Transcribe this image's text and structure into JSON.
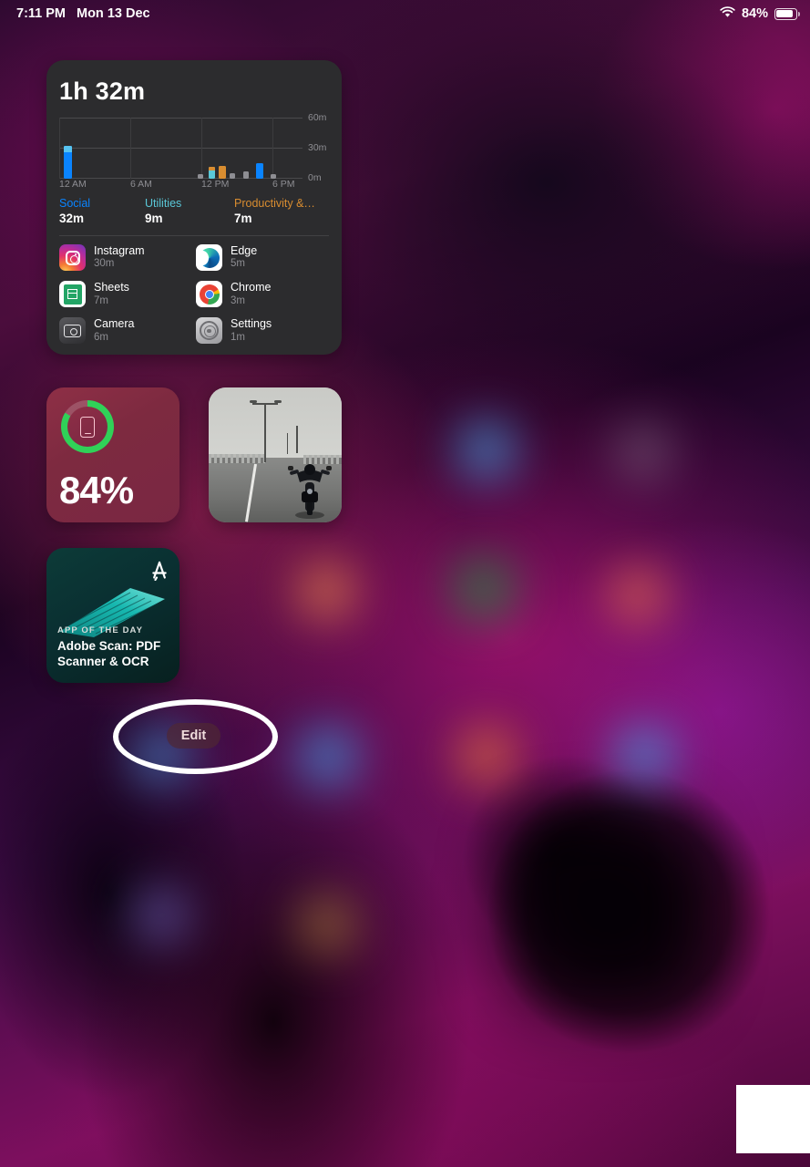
{
  "status_bar": {
    "time": "7:11 PM",
    "date": "Mon 13 Dec",
    "battery_percent": "84%",
    "wifi_icon": "wifi-icon",
    "battery_icon": "battery-icon"
  },
  "screen_time_widget": {
    "total_time": "1h 32m",
    "chart": {
      "y_ticks": [
        "60m",
        "30m",
        "0m"
      ],
      "x_ticks": [
        "12 AM",
        "6 AM",
        "12 PM",
        "6 PM"
      ]
    },
    "categories": [
      {
        "name": "Social",
        "time": "32m",
        "color": "#0a84ff"
      },
      {
        "name": "Utilities",
        "time": "9m",
        "color": "#5ac8d8"
      },
      {
        "name": "Productivity &…",
        "time": "7m",
        "color": "#d98d30"
      }
    ],
    "apps": [
      {
        "name": "Instagram",
        "time": "30m",
        "icon": "instagram-icon"
      },
      {
        "name": "Edge",
        "time": "5m",
        "icon": "edge-icon"
      },
      {
        "name": "Sheets",
        "time": "7m",
        "icon": "sheets-icon"
      },
      {
        "name": "Chrome",
        "time": "3m",
        "icon": "chrome-icon"
      },
      {
        "name": "Camera",
        "time": "6m",
        "icon": "camera-icon"
      },
      {
        "name": "Settings",
        "time": "1m",
        "icon": "settings-icon"
      }
    ]
  },
  "battery_widget": {
    "percent_label": "84%",
    "ring_color": "#30d158",
    "device_icon": "ipad-icon"
  },
  "photo_widget": {
    "description": "motorcycle-on-road-photo"
  },
  "app_store_widget": {
    "kicker": "APP OF THE DAY",
    "title": "Adobe Scan: PDF Scanner & OCR",
    "logo_icon": "app-store-icon"
  },
  "edit_button": {
    "label": "Edit"
  },
  "annotation": {
    "shape": "ellipse-highlight",
    "color": "#ffffff"
  },
  "chart_data": {
    "type": "bar",
    "title": "1h 32m",
    "xlabel": "",
    "ylabel": "",
    "ylim": [
      0,
      60
    ],
    "yticks": [
      0,
      30,
      60
    ],
    "ytick_labels": [
      "0m",
      "30m",
      "60m"
    ],
    "xtick_labels": [
      "12 AM",
      "6 AM",
      "12 PM",
      "6 PM"
    ],
    "grid": true,
    "legend_position": "below",
    "legend": [
      "Social",
      "Utilities",
      "Productivity &…"
    ],
    "series": [
      {
        "name": "Social",
        "color": "#0a84ff",
        "values": [
          32,
          0,
          0,
          0,
          0,
          0,
          0,
          0,
          0,
          0,
          0,
          0,
          0,
          0,
          0,
          0,
          0,
          5,
          0
        ]
      },
      {
        "name": "Utilities",
        "color": "#5ac8d8",
        "values": [
          0,
          0,
          0,
          0,
          0,
          0,
          0,
          0,
          0,
          0,
          0,
          4,
          0,
          0,
          0,
          0,
          0,
          0,
          0
        ]
      },
      {
        "name": "Productivity &…",
        "color": "#d98d30",
        "values": [
          0,
          0,
          0,
          0,
          0,
          0,
          0,
          0,
          0,
          0,
          0,
          1,
          6,
          0,
          0,
          0,
          0,
          0,
          0
        ]
      },
      {
        "name": "Other",
        "color": "#8e8e93",
        "values": [
          0,
          0,
          0,
          0,
          0,
          0,
          0,
          0,
          0,
          0,
          2,
          0,
          0,
          2,
          0,
          3,
          0,
          0,
          2
        ]
      }
    ],
    "x": [
      "12 AM",
      "1 AM",
      "2 AM",
      "3 AM",
      "4 AM",
      "5 AM",
      "6 AM",
      "7 AM",
      "8 AM",
      "9 AM",
      "10 AM",
      "11 AM",
      "12 PM",
      "1 PM",
      "2 PM",
      "3 PM",
      "4 PM",
      "5 PM",
      "6 PM"
    ],
    "category_totals": {
      "Social": 32,
      "Utilities": 9,
      "Productivity &…": 7
    }
  }
}
